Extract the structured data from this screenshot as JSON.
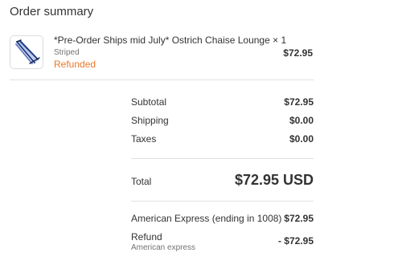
{
  "header": {
    "title": "Order summary"
  },
  "line_item": {
    "thumbnail_icon": "striped-chaise-lounge-image",
    "name": "*Pre-Order Ships mid July* Ostrich Chaise Lounge × 1",
    "variant": "Striped",
    "status": "Refunded",
    "price": "$72.95"
  },
  "totals": {
    "subtotal_label": "Subtotal",
    "subtotal_value": "$72.95",
    "shipping_label": "Shipping",
    "shipping_value": "$0.00",
    "taxes_label": "Taxes",
    "taxes_value": "$0.00",
    "total_label": "Total",
    "total_value": "$72.95 USD"
  },
  "payments": {
    "card_label": "American Express (ending in 1008)",
    "card_value": "$72.95",
    "refund_label": "Refund",
    "refund_method": "American express",
    "refund_value": "- $72.95"
  },
  "colors": {
    "refunded_status": "#e8782a",
    "divider": "#e1e1e1",
    "text": "#333333",
    "muted_text": "#737373"
  }
}
